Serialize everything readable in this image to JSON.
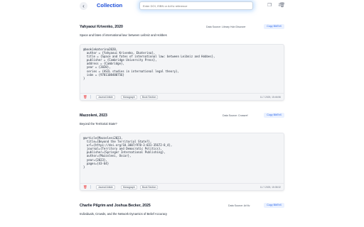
{
  "header": {
    "back_icon": "arrow-left-icon",
    "title": "Collection",
    "search_placeholder": "Enter DOI, ISBN or ArXiv reference",
    "tools": [
      "copy-icon",
      "export-icon",
      "delete-icon"
    ]
  },
  "entries": [
    {
      "author_year": "Yahyaoui Krivenko, 2020",
      "source": "Data Source: Library Hub Discover",
      "copy_label": "Copy BibTeX",
      "title": "Space and fates of international law: between Leibniz and Hobbes",
      "bibtex": "@book{ekaterina2020,\n  author = {Yahyaoui Krivenko, Ekaterina},\n  title = {Space and fates of international law: between Leibniz and Hobbes},\n  publisher = {Cambridge University Press},\n  address = {Cambridge},\n  year = {2020},\n  series = {ASIL studies in international legal theory},\n  isbn = {9781108480756}\n}",
      "tags": [
        "Journal Article",
        "Monograph",
        "Book Section"
      ],
      "timestamp": "11.7.2025, 15:46:56"
    },
    {
      "author_year": "Mazzoleni, 2023",
      "source": "Data Source: Crossref",
      "copy_label": "Copy BibTeX",
      "title": "Beyond the Territorial State?",
      "bibtex": "@article{Mazzoleni2023,\n  title={Beyond the Territorial State?},\n  url={https://doi.org/10.1007/978-3-031-35672-8_4},\n  journal={Territory and Democratic Politics},\n  publisher={Springer International Publishing},\n  author={Mazzoleni, Oscar},\n  year={2023},\n  pages={43-64}\n}",
      "tags": [
        "Journal Article",
        "Monograph",
        "Book Section"
      ],
      "timestamp": "11.7.2025, 15:38:32"
    },
    {
      "author_year": "Charlie Pilgrim and Joshua Becker, 2025",
      "source": "Data Source: ArXiv",
      "copy_label": "Copy BibTeX",
      "title": "Individuals, Crowds, and the Network Dynamics of Belief Accuracy"
    }
  ]
}
